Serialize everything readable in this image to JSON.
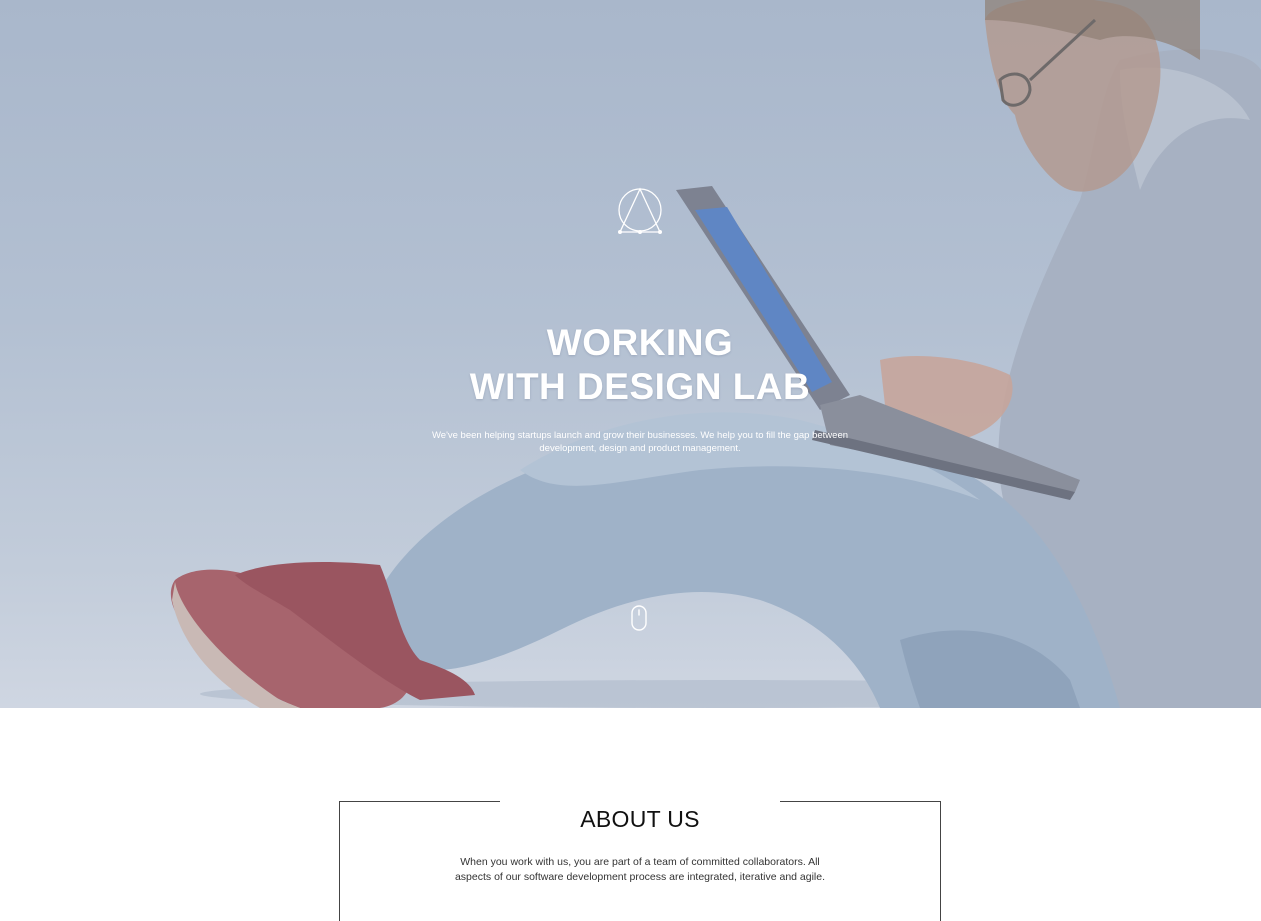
{
  "hero": {
    "title_line1": "WORKING",
    "title_line2": "WITH DESIGN LAB",
    "description": "We've been helping startups launch and grow their businesses. We help you to fill the gap between development, design and product management.",
    "logo_icon": "triangle-circle-logo-icon",
    "scroll_icon": "mouse-scroll-icon"
  },
  "about": {
    "title": "ABOUT US",
    "text": "When you work with us, you are part of a team of committed collaborators. All aspects of our software development process are integrated, iterative and agile."
  },
  "colors": {
    "hero_overlay": "#b3c0d2",
    "text_light": "#ffffff",
    "text_dark": "#111111"
  }
}
